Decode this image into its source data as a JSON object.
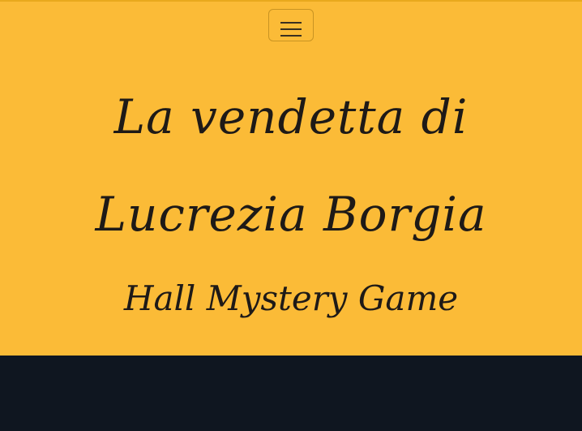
{
  "header": {
    "menu_icon": "hamburger-menu-icon",
    "title": "La vendetta di Lucrezia Borgia",
    "subtitle": "Hall Mystery Game"
  },
  "colors": {
    "hero_background": "#fbbb37",
    "text": "#1e1a17",
    "dark_section": "#0f1620"
  }
}
